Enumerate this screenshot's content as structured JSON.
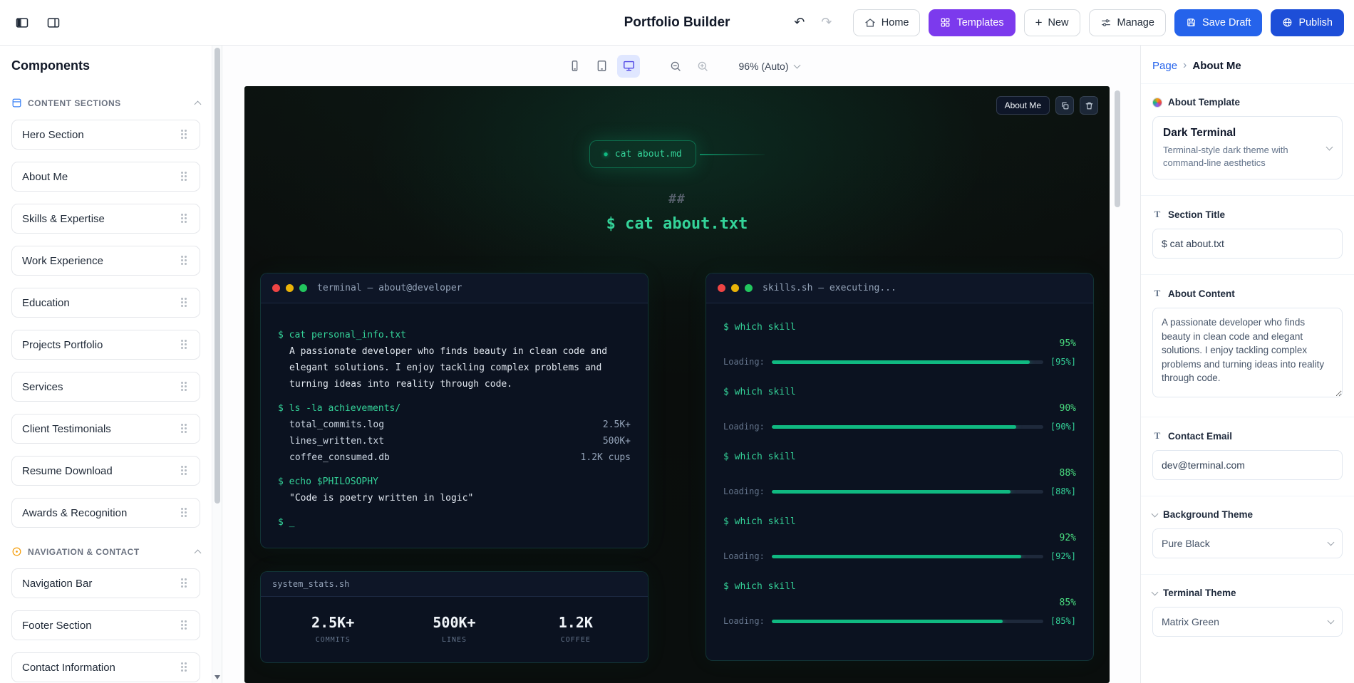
{
  "icons": {
    "undo": "↶",
    "redo": "↷",
    "plus": "+",
    "breadcrumb_separator": "›",
    "tab_dot": "●"
  },
  "header": {
    "title": "Portfolio Builder",
    "home_label": "Home",
    "templates_label": "Templates",
    "new_label": "New",
    "manage_label": "Manage",
    "save_draft_label": "Save Draft",
    "publish_label": "Publish"
  },
  "sidebar": {
    "title": "Components",
    "groups": [
      {
        "label": "CONTENT SECTIONS",
        "items": [
          "Hero Section",
          "About Me",
          "Skills & Expertise",
          "Work Experience",
          "Education",
          "Projects Portfolio",
          "Services",
          "Client Testimonials",
          "Resume Download",
          "Awards & Recognition"
        ]
      },
      {
        "label": "NAVIGATION & CONTACT",
        "items": [
          "Navigation Bar",
          "Footer Section",
          "Contact Information"
        ]
      }
    ]
  },
  "canvas": {
    "toolbar": {
      "zoom_label": "96% (Auto)"
    },
    "overlay": {
      "section_label": "About Me"
    },
    "preview": {
      "tab_label": "cat about.md",
      "hash": "##",
      "title_command": "$ cat about.txt",
      "terminal_left": {
        "title": "terminal — about@developer",
        "lines": [
          {
            "type": "cmd",
            "text": "$ cat personal_info.txt",
            "value": ""
          },
          {
            "type": "out",
            "text": "A passionate developer who finds beauty in clean code and elegant solutions. I enjoy tackling complex problems and turning ideas into reality through code.",
            "value": ""
          },
          {
            "type": "cmd",
            "text": "$ ls -la achievements/",
            "value": ""
          },
          {
            "type": "file",
            "text": "total_commits.log",
            "value": "2.5K+"
          },
          {
            "type": "file",
            "text": "lines_written.txt",
            "value": "500K+"
          },
          {
            "type": "file",
            "text": "coffee_consumed.db",
            "value": "1.2K cups"
          },
          {
            "type": "cmd",
            "text": "$ echo $PHILOSOPHY",
            "value": ""
          },
          {
            "type": "out",
            "text": "\"Code is poetry written in logic\"",
            "value": ""
          },
          {
            "type": "cursor",
            "text": "$ _",
            "value": ""
          }
        ]
      },
      "terminal_right": {
        "title": "skills.sh — executing...",
        "skills": [
          {
            "command": "$ which skill",
            "percent": "95%",
            "loading_label": "Loading:",
            "bracket": "[95%]",
            "value": 95
          },
          {
            "command": "$ which skill",
            "percent": "90%",
            "loading_label": "Loading:",
            "bracket": "[90%]",
            "value": 90
          },
          {
            "command": "$ which skill",
            "percent": "88%",
            "loading_label": "Loading:",
            "bracket": "[88%]",
            "value": 88
          },
          {
            "command": "$ which skill",
            "percent": "92%",
            "loading_label": "Loading:",
            "bracket": "[92%]",
            "value": 92
          },
          {
            "command": "$ which skill",
            "percent": "85%",
            "loading_label": "Loading:",
            "bracket": "[85%]",
            "value": 85
          }
        ]
      },
      "stats": {
        "title": "system_stats.sh",
        "items": [
          {
            "value": "2.5K+",
            "label": "COMMITS"
          },
          {
            "value": "500K+",
            "label": "LINES"
          },
          {
            "value": "1.2K",
            "label": "COFFEE"
          }
        ]
      }
    }
  },
  "properties": {
    "breadcrumb": {
      "root": "Page",
      "current": "About Me"
    },
    "template_section": {
      "label": "About Template",
      "name": "Dark Terminal",
      "description": "Terminal-style dark theme with command-line aesthetics"
    },
    "section_title": {
      "label": "Section Title",
      "value": "$ cat about.txt"
    },
    "about_content": {
      "label": "About Content",
      "value": "A passionate developer who finds beauty in clean code and elegant solutions. I enjoy tackling complex problems and turning ideas into reality through code."
    },
    "contact_email": {
      "label": "Contact Email",
      "value": "dev@terminal.com"
    },
    "background_theme": {
      "label": "Background Theme",
      "value": "Pure Black"
    },
    "terminal_theme": {
      "label": "Terminal Theme",
      "value": "Matrix Green"
    }
  }
}
